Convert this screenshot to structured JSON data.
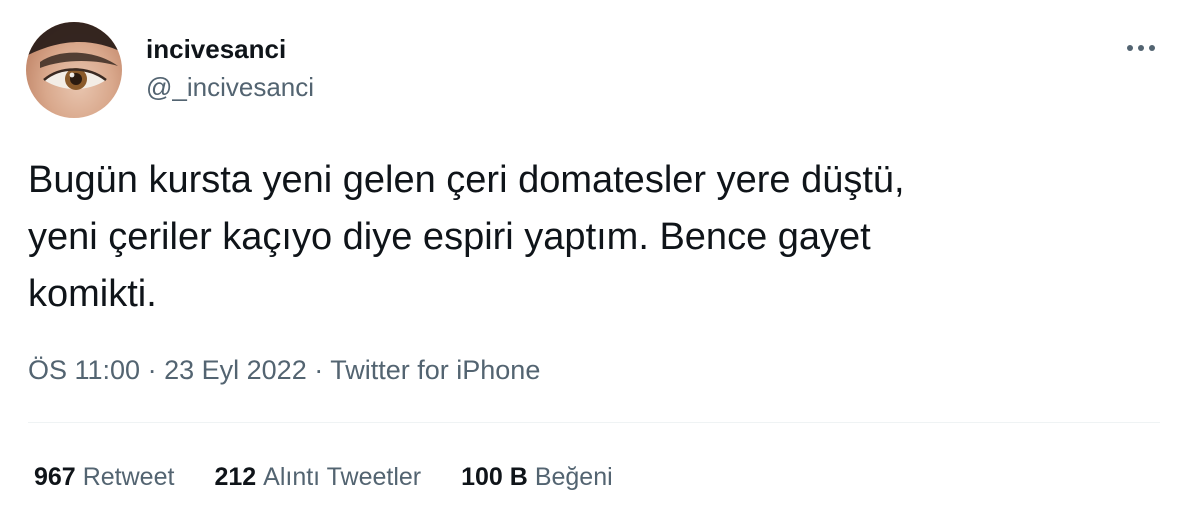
{
  "author": {
    "display_name": "incivesanci",
    "handle": "@_incivesanci"
  },
  "tweet": {
    "text": "Bugün kursta yeni gelen çeri domatesler yere düştü,\nyeni çeriler kaçıyo diye espiri yaptım. Bence gayet\nkomikti."
  },
  "meta": {
    "time": "ÖS 11:00",
    "separator": "·",
    "date": "23 Eyl 2022",
    "source": "Twitter for iPhone"
  },
  "stats": {
    "retweets": {
      "count": "967",
      "label": "Retweet"
    },
    "quotes": {
      "count": "212",
      "label": "Alıntı Tweetler"
    },
    "likes": {
      "count": "100 B",
      "label": "Beğeni"
    }
  },
  "icons": {
    "more": "more-horizontal-icon"
  },
  "colors": {
    "text_primary": "#0f1419",
    "text_secondary": "#536471",
    "divider": "#eff3f4"
  }
}
